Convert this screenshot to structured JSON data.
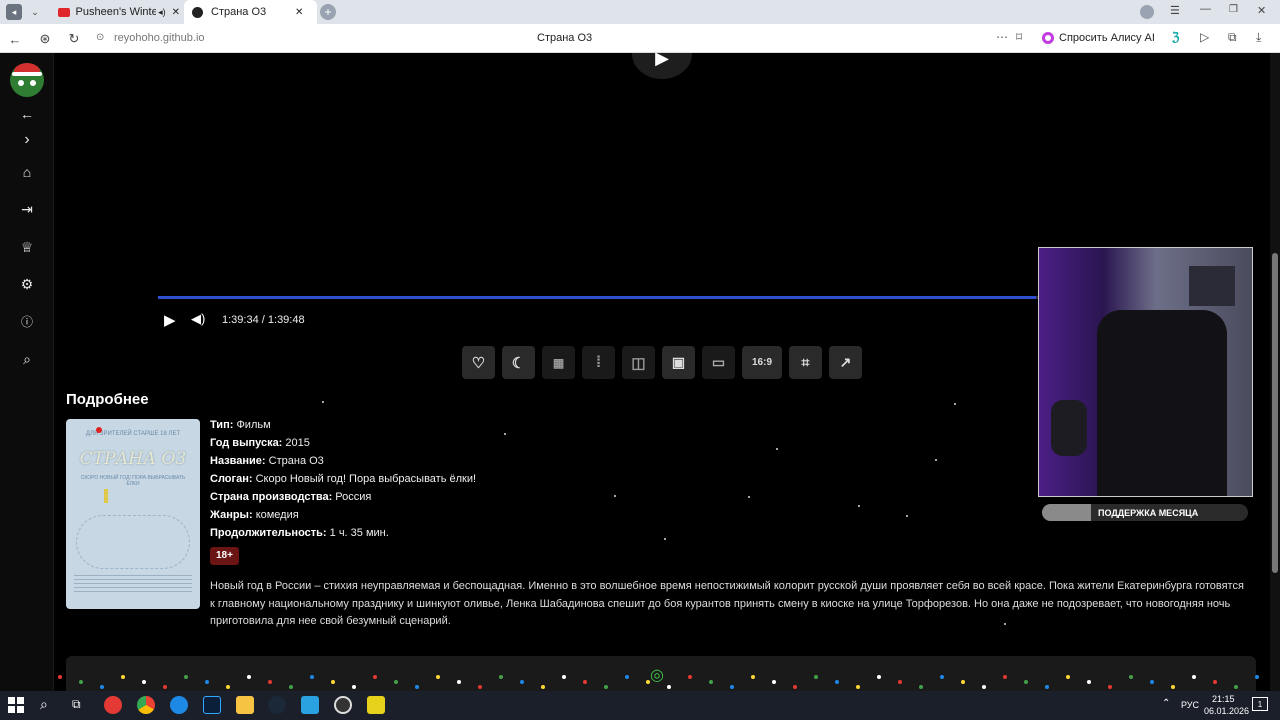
{
  "browser": {
    "tabs": [
      {
        "title": "Pusheen's Winter Ch",
        "active": false
      },
      {
        "title": "Страна О3",
        "active": true
      }
    ],
    "url": "reyohoho.github.io",
    "page_title": "Страна О3",
    "ask_alice": "Спросить Алису AI"
  },
  "player": {
    "current_time": "1:39:34",
    "separator": "/",
    "duration": "1:39:48",
    "progress_fraction": 0.998,
    "tools": [
      {
        "name": "favorite-button",
        "label": "",
        "icon": "heart-icon",
        "glyph": "♡"
      },
      {
        "name": "dim-button",
        "label": "",
        "icon": "moon-icon",
        "glyph": "☾"
      },
      {
        "name": "grid-button",
        "label": "",
        "icon": "grid-icon",
        "glyph": "▦"
      },
      {
        "name": "audio-button",
        "label": "",
        "icon": "waveform-icon",
        "glyph": "⁞"
      },
      {
        "name": "mirror-button",
        "label": "",
        "icon": "split-icon",
        "glyph": "◫"
      },
      {
        "name": "picture-button",
        "label": "",
        "icon": "image-icon",
        "glyph": "▣"
      },
      {
        "name": "pip-button",
        "label": "",
        "icon": "pip-icon",
        "glyph": "▭"
      },
      {
        "name": "aspect-button",
        "label": "16:9",
        "icon": "",
        "glyph": ""
      },
      {
        "name": "screenshot-button",
        "label": "",
        "icon": "focus-icon",
        "glyph": "⌗"
      },
      {
        "name": "open-external-button",
        "label": "",
        "icon": "external-link-icon",
        "glyph": "↗"
      }
    ]
  },
  "details": {
    "heading": "Подробнее",
    "type_label": "Тип:",
    "type_value": "Фильм",
    "year_label": "Год выпуска:",
    "year_value": "2015",
    "name_label": "Название:",
    "name_value": "Страна О3",
    "slogan_label": "Слоган:",
    "slogan_value": "Скоро Новый год! Пора выбрасывать ёлки!",
    "country_label": "Страна производства:",
    "country_value": "Россия",
    "genres_label": "Жанры:",
    "genres_value": "комедия",
    "duration_label": "Продолжительность:",
    "duration_value": "1 ч. 35 мин.",
    "age_rating": "18+",
    "description": "Новый год в России – стихия неуправляемая и беспощадная. Именно в это волшебное время непостижимый колорит русской души проявляет себя во всей красе. Пока жители Екатеринбурга готовятся к главному национальному празднику и шинкуют оливье, Ленка Шабадинова спешит до боя курантов принять смену в киоске на улице Торфорезов. Но она даже не подозревает, что новогодняя ночь приготовила для нее свой безумный сценарий.",
    "poster": {
      "top_text": "ДЛЯ ЗРИТЕЛЕЙ СТАРШЕ 18 ЛЕТ",
      "title": "СТРАНА О3",
      "tagline": "СКОРО НОВЫЙ ГОД! ПОРА ВЫБРАСЫВАТЬ ЁЛКИ"
    }
  },
  "webcam": {
    "support_label": "ПОДДЕРЖКА МЕСЯЦА",
    "progress_fraction": 0.24
  },
  "taskbar": {
    "lang": "РУС",
    "time": "21:15",
    "date": "06.01.2026",
    "notifications": "1"
  },
  "colors": {
    "progress": "#2f4fd0",
    "age_badge_bg": "#6b1414",
    "poster_bg": "#c7d7e3"
  }
}
